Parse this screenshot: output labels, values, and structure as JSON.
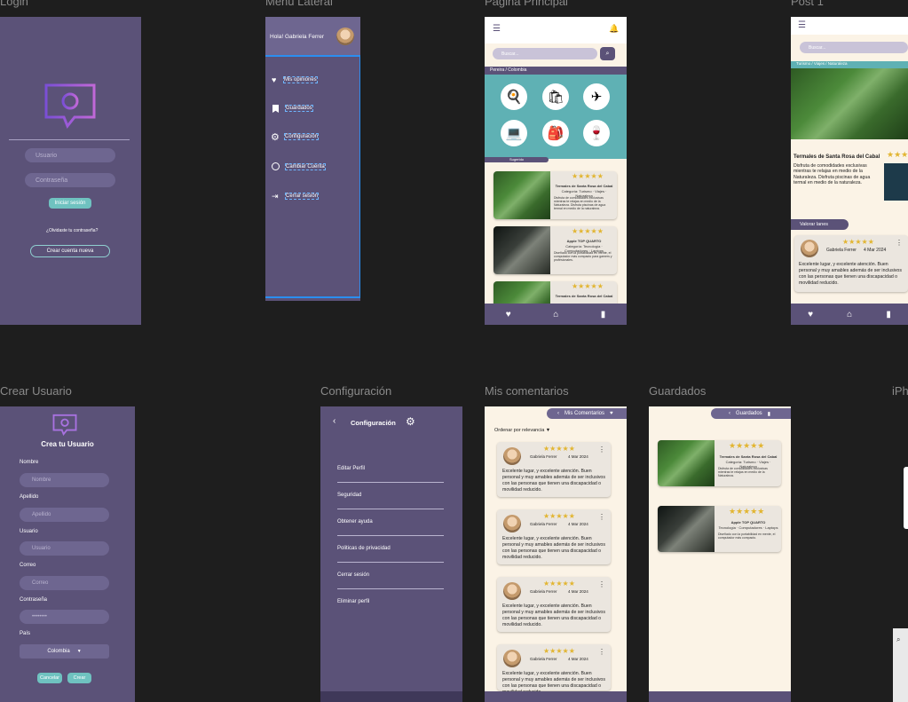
{
  "frames": {
    "login": "Login",
    "menu": "Menu Lateral",
    "main": "Pagina Principal",
    "post": "Post 1",
    "create": "Crear Usuario",
    "config": "Configuración",
    "comments": "Mis comentarios",
    "saved": "Guardados",
    "iphone": "iPh"
  },
  "login": {
    "user_placeholder": "Usuario",
    "pass_placeholder": "Contraseña",
    "login_btn": "Iniciar sesión",
    "forgot": "¿Olvidaste tu contraseña?",
    "create_btn": "Crear cuenta nueva"
  },
  "menu": {
    "greeting": "Hola! Gabriela Ferrer",
    "items": [
      "Mis opiniones",
      "Guardados",
      "Configuración",
      "Cambiar Cuenta",
      "Cerrar sesión"
    ]
  },
  "main": {
    "search_placeholder": "Buscar...",
    "location": "Pereira / Colombia",
    "tag": "Sugerido",
    "cards": [
      {
        "title": "Termales de Santa Rosa del Cabal",
        "cat": "Categoría: Turismo · Viajes · Naturaleza",
        "desc": "Disfruta de comodidades exclusivas mientras te relajas en medio de la Naturaleza. Disfruta piscinas de agua termal en medio de la naturaleza."
      },
      {
        "title": "Apple TOP QUARTO",
        "cat": "Categoría: Tecnología · Computadores · Laptops",
        "desc": "Diseñado con la portabilidad en mente, el computador más compacto para gamers y profesionales."
      },
      {
        "title": "Termales de Santa Rosa del Cabal",
        "cat": "",
        "desc": ""
      }
    ]
  },
  "post": {
    "search_placeholder": "Buscar...",
    "breadcrumb": "Turismo / Viajes / Naturaleza",
    "title": "Termales de Santa Rosa del Cabal",
    "desc": "Disfruta de comodidades exclusivas mientras te relajas en medio de la Naturaleza. Disfruta piscinas de agua termal en medio de la naturaleza.",
    "rate_btn": "Valorar lanes",
    "reviewer": "Gabriela Ferrer",
    "date": "4 Mar 2024",
    "review": "Excelente lugar, y excelente atención. Buen personal y muy amables además de ser inclusivos con las personas que tienen una discapacidad o movilidad reducido."
  },
  "create": {
    "title": "Crea tu Usuario",
    "fields": [
      {
        "label": "Nombre",
        "placeholder": "Nombre"
      },
      {
        "label": "Apellido",
        "placeholder": "Apellido"
      },
      {
        "label": "Usuario",
        "placeholder": "Usuario"
      },
      {
        "label": "Correo",
        "placeholder": "Correo"
      },
      {
        "label": "Contraseña",
        "placeholder": "••••••••"
      }
    ],
    "country_label": "País",
    "country": "Colombia",
    "cancel": "Cancelar",
    "create": "Crear"
  },
  "config": {
    "title": "Configuración",
    "items": [
      "Editar Perfil",
      "Seguridad",
      "Obtener ayuda",
      "Politicas de privacidad",
      "Cerrar sesión",
      "Eliminar perfil"
    ]
  },
  "comments": {
    "header": "Mis Comentarios",
    "sort": "Ordenar por relevancia",
    "reviewer": "Gabriela Ferrer",
    "date": "4 Mar 2024",
    "text": "Excelente lugar, y excelente atención. Buen personal y muy amables además de ser inclusivos con las personas que tienen una discapacidad o movilidad reducido."
  },
  "saved": {
    "header": "Guardados",
    "cards": [
      {
        "title": "Termales de Santa Rosa del Cabal",
        "cat": "Categoría: Turismo · Viajes · Naturaleza",
        "desc": "Disfruta de comodidades exclusivas mientras te relajas en medio de la Naturaleza."
      },
      {
        "title": "Apple TOP QUARTO",
        "cat": "Tecnología · Computadores · Laptops",
        "desc": "Diseñado con la portabilidad en mente, el computador más compacto."
      }
    ]
  },
  "colors": {
    "purple": "#5b5278",
    "teal": "#6fc2c0",
    "cream": "#fbf3e6",
    "star": "#e2b531"
  }
}
